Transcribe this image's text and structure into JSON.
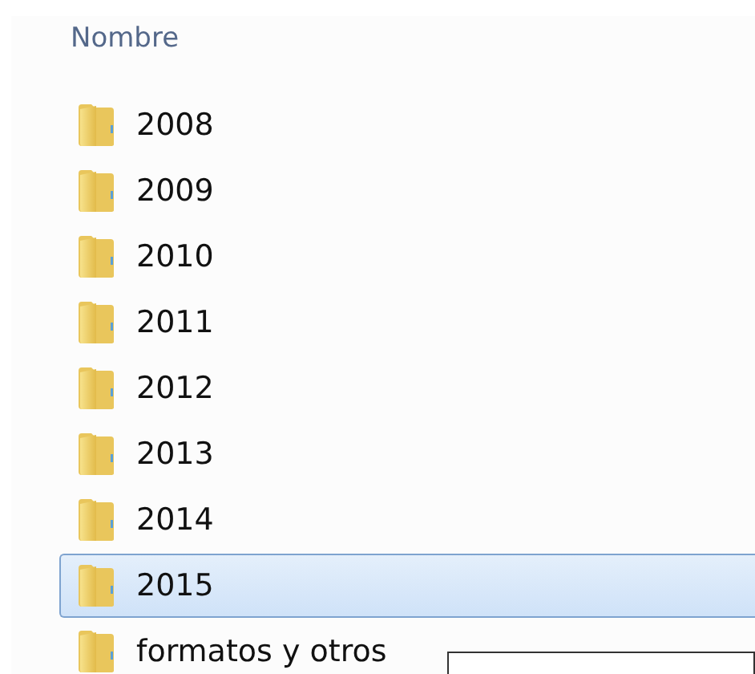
{
  "columns": [
    {
      "label": "Nombre"
    }
  ],
  "items": [
    {
      "name": "2008",
      "selected": false
    },
    {
      "name": "2009",
      "selected": false
    },
    {
      "name": "2010",
      "selected": false
    },
    {
      "name": "2011",
      "selected": false
    },
    {
      "name": "2012",
      "selected": false
    },
    {
      "name": "2013",
      "selected": false
    },
    {
      "name": "2014",
      "selected": false
    },
    {
      "name": "2015",
      "selected": true
    },
    {
      "name": "formatos y otros",
      "selected": false,
      "popup": true
    }
  ]
}
